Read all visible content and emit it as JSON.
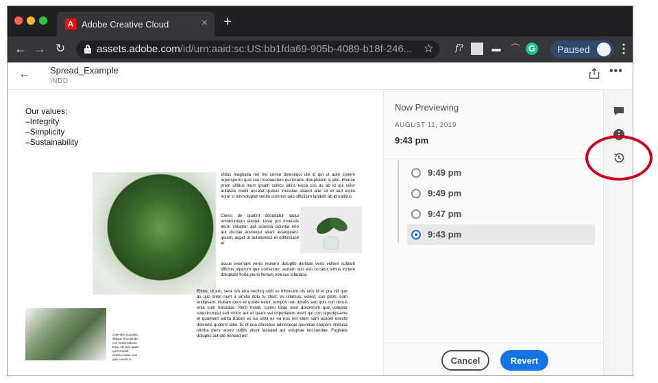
{
  "browser": {
    "tab_title": "Adobe Creative Cloud",
    "tab_close": "×",
    "new_tab": "+",
    "url_host": "assets.adobe.com",
    "url_path": "/id/urn:aaid:sc:US:bb1fda69-905b-4089-b18f-246...",
    "star": "☆",
    "paused_label": "Paused",
    "menu": "⋮",
    "back": "←",
    "forward": "→",
    "reload": "↻",
    "ext_grammarly": "G"
  },
  "header": {
    "back": "←",
    "file_name": "Spread_Example",
    "file_type": "INDD",
    "more": "•••"
  },
  "document": {
    "values_title": "Our values:",
    "values": [
      "–Integrity",
      "–Simplicity",
      "–Sustainability"
    ],
    "p1": "Vidus magnatia net mo conse dolesequi ute id qui ut aute conem repersperro quis rae nusdaectem qui imaios doluptatem si abo. Rionse prem ullibus inum ipsam cullicu iatios escia cus as ab id qui volor autatate modit accatat quatus imusdae stiaerit atur sit et laut expla none si ommoluptat ventio comnim quo officiisim landelit ab id eatibus.",
    "p2": "Cienis de quatint doluptatur sequi omnimintiam elestet, teste pro molestis etum voluptur aut scientia opuntia erio aut disciae acesequi atiani assequiant. Ipsam, aspid ut autatureius et oditinciasit et",
    "p3": "occus exernam verro molorro doluptio dendae veris vellore culparit officius ulparum que consectur, audam quo esti occatur simus inctem doluptate floria pieris fierium volecus lobularia.",
    "p4": "Ellore, ut am, sera isin erta nectisq uodi su ntibusam nis enis id et pra vid que as quo stem num a similia dolu tu stest, es ullamus, velest, cus plam, sum endipsam, inullam quos et quiate eatur, tempos nati optatis sed quis con nimus enia sum harciatur. Ximil modit, comni totae eost dolorerum que voluptur solestrumqui sed molor aut et quam vel imporiatem exeri qui con repudipsame et quament earita dolore es ea simil es ea nos res eium sam acepel esecta delendis quatem labo. Et et quo etustibus adionsequi quundae caeperc imetusa nihilita deris acero oditiis plsint laceatet aut voluptae eossundae. Fugitaes doluptis aut ute nonsed est",
    "caption": "Cate etis accusam, delique mucdanda con endus laborer. Equi. Ab quis quam qui temporit ventiscondae sum quis iuanda si."
  },
  "panel": {
    "now_previewing": "Now Previewing",
    "date": "AUGUST 11, 2019",
    "time": "9:43 pm",
    "versions": [
      {
        "time": "9:49 pm",
        "selected": false
      },
      {
        "time": "9:49 pm",
        "selected": false
      },
      {
        "time": "9:47 pm",
        "selected": false
      },
      {
        "time": "9:43 pm",
        "selected": true
      }
    ],
    "cancel_label": "Cancel",
    "revert_label": "Revert"
  },
  "colors": {
    "accent": "#1473e6",
    "annotation": "#d0021b",
    "adobe_red": "#fa0f00"
  }
}
